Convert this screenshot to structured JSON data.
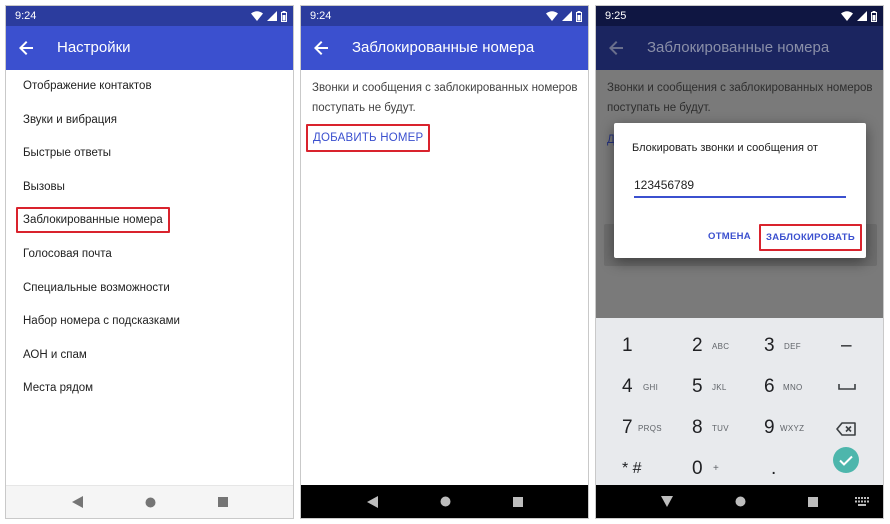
{
  "screens": [
    {
      "status_time": "9:24",
      "title": "Настройки",
      "menu_items": [
        "Отображение контактов",
        "Звуки и вибрация",
        "Быстрые ответы",
        "Вызовы",
        "Заблокированные номера",
        "Голосовая почта",
        "Специальные возможности",
        "Набор номера с подсказками",
        "АОН и спам",
        "Места рядом"
      ],
      "highlighted_item": "Заблокированные номера"
    },
    {
      "status_time": "9:24",
      "title": "Заблокированные номера",
      "description": "Звонки и сообщения с заблокированных номеров поступать не будут.",
      "add_button": "ДОБАВИТЬ НОМЕР"
    },
    {
      "status_time": "9:25",
      "title": "Заблокированные номера",
      "description": "Звонки и сообщения с заблокированных номеров поступать не будут.",
      "add_button_partial": "Д",
      "dialog": {
        "title": "Блокировать звонки и сообщения от",
        "input_value": "123456789",
        "cancel": "ОТМЕНА",
        "confirm": "ЗАБЛОКИРОВАТЬ"
      },
      "keypad": [
        [
          {
            "digit": "1",
            "letters": ""
          },
          {
            "digit": "2",
            "letters": "ABC"
          },
          {
            "digit": "3",
            "letters": "DEF"
          },
          {
            "digit": "–",
            "letters": ""
          }
        ],
        [
          {
            "digit": "4",
            "letters": "GHI"
          },
          {
            "digit": "5",
            "letters": "JKL"
          },
          {
            "digit": "6",
            "letters": "MNO"
          },
          {
            "digit": "",
            "letters": "",
            "icon": "space-bar-icon"
          }
        ],
        [
          {
            "digit": "7",
            "letters": "PRQS"
          },
          {
            "digit": "8",
            "letters": "TUV"
          },
          {
            "digit": "9",
            "letters": "WXYZ"
          },
          {
            "digit": "",
            "letters": "",
            "icon": "backspace-icon"
          }
        ],
        [
          {
            "digit": "* #",
            "letters": ""
          },
          {
            "digit": "0",
            "letters": "+"
          },
          {
            "digit": ".",
            "letters": ""
          },
          {
            "digit": "",
            "letters": "",
            "icon": "check-icon"
          }
        ]
      ]
    }
  ],
  "colors": {
    "statusbar": "#2b3c9e",
    "appbar": "#3b50cf",
    "accent": "#3b50cf",
    "highlight_border": "#d9232d",
    "confirm_key": "#4db6ac"
  },
  "icons": {
    "status": [
      "wifi-icon",
      "signal-icon",
      "battery-icon"
    ],
    "appbar": "back-arrow-icon",
    "nav": [
      "back-triangle-icon",
      "home-circle-icon",
      "recents-square-icon",
      "keyboard-switch-icon"
    ]
  }
}
